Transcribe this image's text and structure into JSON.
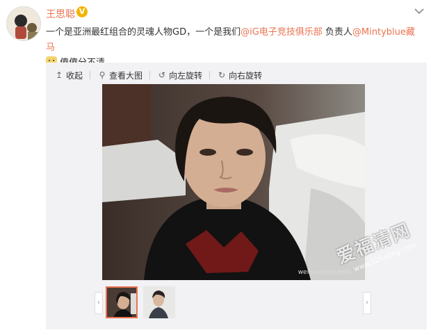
{
  "post": {
    "author": "王思聪",
    "verified_badge": "V",
    "text_1": "一个是亚洲最红组合的灵魂人物GD，一个是我们",
    "mention_1": "@iG电子竞技俱乐部",
    "text_2": " 负责人",
    "mention_2": "@Mintyblue藏马",
    "text_3": "傻傻分不清",
    "more_icon": "chevron-down-icon"
  },
  "toolbar": {
    "collapse_label": "收起",
    "view_large_label": "查看大图",
    "rotate_left_label": "向左旋转",
    "rotate_right_label": "向右旋转"
  },
  "photo": {
    "watermark_text": "weibo.com/sephi..."
  },
  "site_watermark": {
    "title": "爱福清网",
    "url": "www.52fuqing.com"
  },
  "colors": {
    "accent": "#eb7350",
    "panel": "#f2f2f5"
  }
}
